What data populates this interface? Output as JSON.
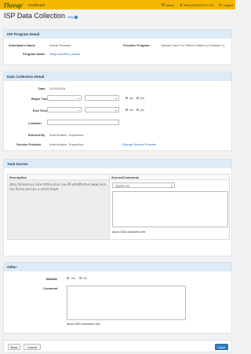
{
  "topbar": {
    "logo": "Therap",
    "logo_mark": "®",
    "dashboard": "Dashboard",
    "inbox": "Inbox",
    "user": "Amit (DEMOTO-TC2)",
    "logout": "Logout"
  },
  "page": {
    "title": "ISP Data Collection",
    "help": "Help"
  },
  "program_detail": {
    "heading": "ISP Program Detail",
    "individual_label": "Individual's Name",
    "individual_value": "Anwar Rahman",
    "provider_label": "Provider Program",
    "provider_value": "Special Care For Gifted Children (Outreach 1)",
    "program_label": "Program Name",
    "program_value": "Daily Activities_Anwar"
  },
  "collection_detail": {
    "heading": "Data Collection Detail",
    "date_label": "Date",
    "date_value": "01/01/2016",
    "begin_label": "Begin Time",
    "end_label": "End Time",
    "am": "am",
    "pm": "pm",
    "location_label": "Location",
    "entered_label": "Entered By",
    "entered_value": "Amit Ibrahim, Supervisor",
    "provider_label": "Service Provider",
    "provider_value": "Amit Ibrahim, Supervisor",
    "change_link": "Change Service Provider"
  },
  "task_scores": {
    "heading": "Task Scores",
    "col_desc": "Description",
    "col_scores": "Scores/Comments",
    "desc_text": "প্রথমে নিজেদের ঘর থেকে পশ্চাতে যাবো এবং কী কার্যকরীর ধরন সম্বন্ধে জানে পরে নিজের অংশ যত ও জায়গা উল্লেখ",
    "score_selected": "প্রযোজ্য নয়",
    "counter": "About 3000 characters left"
  },
  "other": {
    "heading": "Other",
    "billable_label": "Billable",
    "yes": "Yes",
    "no": "No",
    "comment_label": "Comment",
    "counter": "About 3000 characters left"
  },
  "footer": {
    "back": "Back",
    "cancel": "Cancel",
    "save": "Save"
  }
}
